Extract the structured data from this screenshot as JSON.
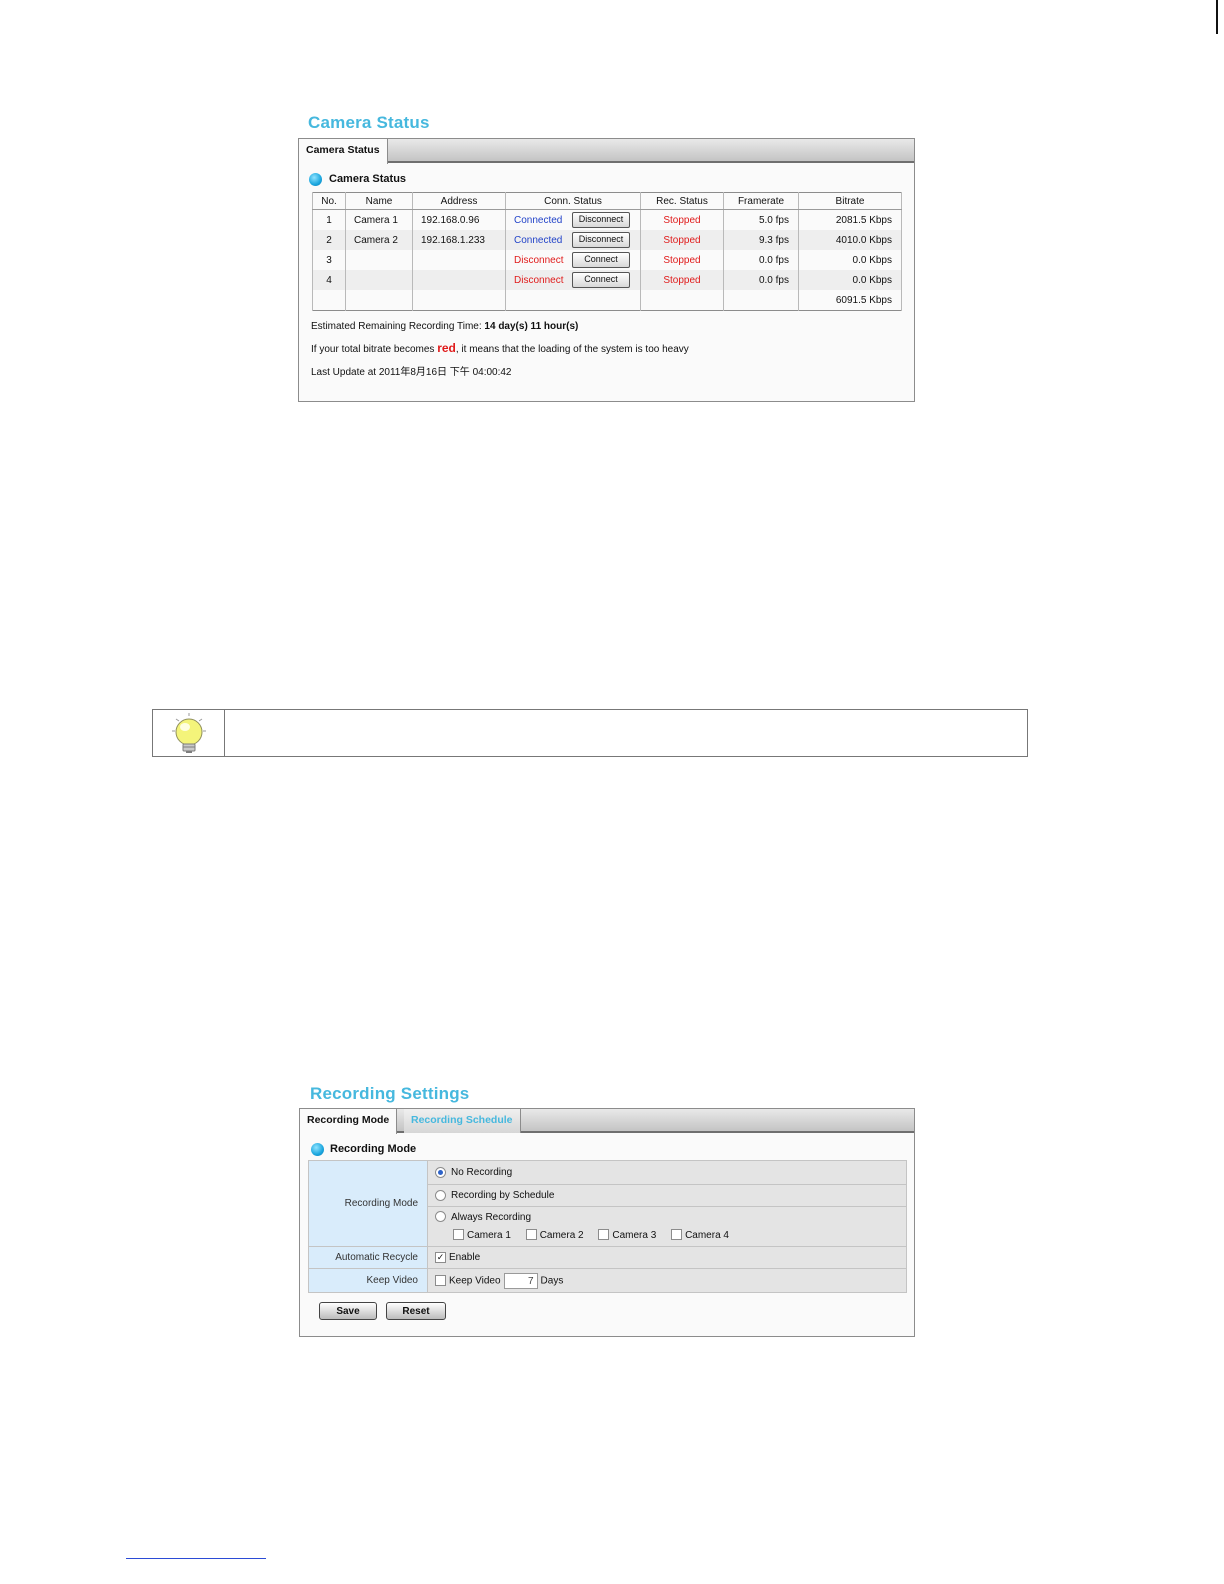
{
  "camera_status": {
    "title": "Camera Status",
    "tab": "Camera Status",
    "section_heading": "Camera Status",
    "columns": [
      "No.",
      "Name",
      "Address",
      "Conn. Status",
      "Rec. Status",
      "Framerate",
      "Bitrate"
    ],
    "rows": [
      {
        "no": "1",
        "name": "Camera 1",
        "address": "192.168.0.96",
        "conn": "Connected",
        "action": "Disconnect",
        "rec": "Stopped",
        "framerate": "5.0 fps",
        "bitrate": "2081.5 Kbps"
      },
      {
        "no": "2",
        "name": "Camera 2",
        "address": "192.168.1.233",
        "conn": "Connected",
        "action": "Disconnect",
        "rec": "Stopped",
        "framerate": "9.3 fps",
        "bitrate": "4010.0 Kbps"
      },
      {
        "no": "3",
        "name": "",
        "address": "",
        "conn": "Disconnect",
        "action": "Connect",
        "rec": "Stopped",
        "framerate": "0.0 fps",
        "bitrate": "0.0 Kbps"
      },
      {
        "no": "4",
        "name": "",
        "address": "",
        "conn": "Disconnect",
        "action": "Connect",
        "rec": "Stopped",
        "framerate": "0.0 fps",
        "bitrate": "0.0 Kbps"
      }
    ],
    "total_bitrate": "6091.5 Kbps",
    "remaining_label": "Estimated Remaining Recording Time:",
    "remaining_value": "14 day(s) 11 hour(s)",
    "warning_before": "If your total bitrate becomes",
    "warning_red": "red",
    "warning_after": ", it means that the loading of the system is too heavy",
    "last_update": "Last Update at 2011年8月16日 下午 04:00:42"
  },
  "recording_settings": {
    "title": "Recording Settings",
    "tabs": [
      "Recording Mode",
      "Recording Schedule"
    ],
    "section_heading": "Recording Mode",
    "mode_label": "Recording Mode",
    "options": [
      "No Recording",
      "Recording by Schedule",
      "Always Recording"
    ],
    "selected_option": "No Recording",
    "cameras": [
      "Camera 1",
      "Camera 2",
      "Camera 3",
      "Camera 4"
    ],
    "recycle_label": "Automatic Recycle",
    "recycle_option": "Enable",
    "recycle_checked": true,
    "keep_label": "Keep Video",
    "keep_option": "Keep Video",
    "keep_days_value": "7",
    "keep_days_unit": "Days",
    "save_label": "Save",
    "reset_label": "Reset"
  },
  "colors": {
    "accent": "#46b8de",
    "connected": "#2243c8",
    "alert": "#e01b1b"
  },
  "icons": [
    "lightbulb-icon"
  ]
}
